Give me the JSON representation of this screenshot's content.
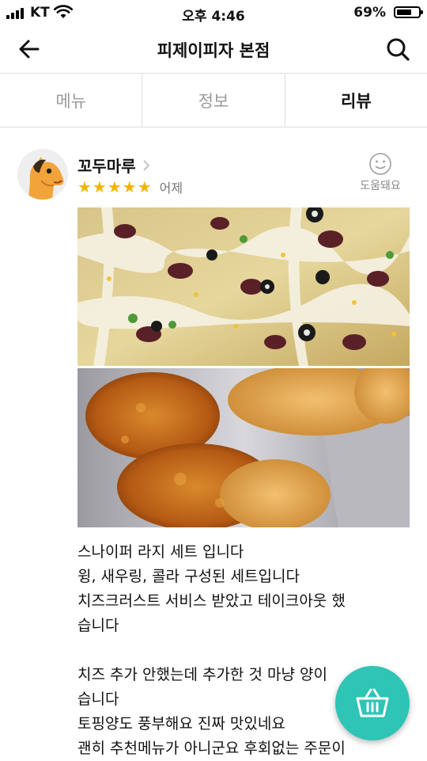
{
  "status_bar": {
    "carrier": "KT",
    "time": "오후 4:46",
    "battery": "69%",
    "battery_level": 0.69
  },
  "header": {
    "title": "피제이피자 본점"
  },
  "tabs": [
    {
      "label": "메뉴",
      "active": false
    },
    {
      "label": "정보",
      "active": false
    },
    {
      "label": "리뷰",
      "active": true
    }
  ],
  "review": {
    "reviewer": "꼬두마루",
    "rating": 5,
    "stars": "★★★★★",
    "date": "어제",
    "helpful_label": "도움돼요",
    "text_lines": [
      "스나이퍼 라지 세트 입니다",
      "윙, 새우링, 콜라 구성된 세트입니다",
      "치즈크러스트 서비스 받았고 테이크아웃 했",
      "습니다",
      "",
      "치즈 추가 안했는데 추가한 것 마냥 양이",
      "습니다",
      "토핑양도 풍부해요 진짜 맛있네요",
      "괜히 추천메뉴가 아니군요 후회없는 주문이"
    ]
  },
  "colors": {
    "accent": "#2ec4b6",
    "star": "#f5b301"
  }
}
